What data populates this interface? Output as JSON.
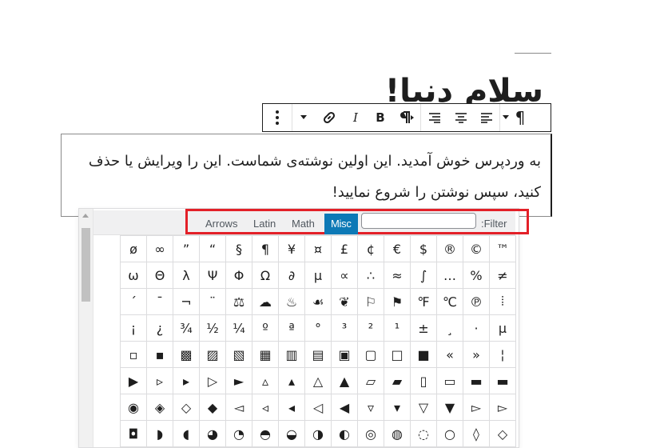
{
  "post_title": "سلام دنیا!",
  "toolbar": {
    "paragraph_label": "¶",
    "align_right_icon": "align-right-icon",
    "align_center_icon": "align-center-icon",
    "align_left_icon": "align-left-icon",
    "rtl_icon": "rtl-paragraph-icon",
    "bold_label": "B",
    "italic_label": "I",
    "link_icon": "link-icon",
    "more_icon": "chevron-down-icon",
    "options_icon": "more-vertical-icon"
  },
  "paragraph_text": "به وردپرس خوش آمدید. این اولین نوشته‌ی شماست. این را ویرایش یا حذف کنید، سپس نوشتن را شروع نمایید!",
  "charmap": {
    "tabs": [
      "Arrows",
      "Latin",
      "Math",
      "Misc"
    ],
    "active_tab": "Misc",
    "filter_label": ":Filter",
    "filter_value": "",
    "rows": [
      [
        "ø",
        "∞",
        "”",
        "“",
        "§",
        "¶",
        "¥",
        "¤",
        "£",
        "¢",
        "€",
        "$",
        "®",
        "©",
        "™"
      ],
      [
        "ω",
        "Θ",
        "λ",
        "Ψ",
        "Φ",
        "Ω",
        "∂",
        "µ",
        "∝",
        "∴",
        "≈",
        "∫",
        "…",
        "%",
        "≠"
      ],
      [
        "´",
        "¯",
        "¬",
        "¨",
        "⚖",
        "☁",
        "♨",
        "☙",
        "❦",
        "⚐",
        "⚑",
        "℉",
        "℃",
        "℗",
        "⦙"
      ],
      [
        "¡",
        "¿",
        "¾",
        "½",
        "¼",
        "º",
        "ª",
        "°",
        "³",
        "²",
        "¹",
        "±",
        "¸",
        "·",
        "µ"
      ],
      [
        "▫",
        "▪",
        "▩",
        "▨",
        "▧",
        "▦",
        "▥",
        "▤",
        "▣",
        "▢",
        "□",
        "■",
        "«",
        "»",
        "¦"
      ],
      [
        "▶",
        "▹",
        "▸",
        "▷",
        "►",
        "▵",
        "▴",
        "△",
        "▲",
        "▱",
        "▰",
        "▯",
        "▭",
        "▬",
        "▬"
      ],
      [
        "◉",
        "◈",
        "◇",
        "◆",
        "◅",
        "◃",
        "◂",
        "◁",
        "◀",
        "▿",
        "▾",
        "▽",
        "▼",
        "▻",
        "▻"
      ],
      [
        "◘",
        "◗",
        "◖",
        "◕",
        "◔",
        "◓",
        "◒",
        "◑",
        "◐",
        "◎",
        "◍",
        "◌",
        "○",
        "◊",
        "◇"
      ]
    ]
  }
}
